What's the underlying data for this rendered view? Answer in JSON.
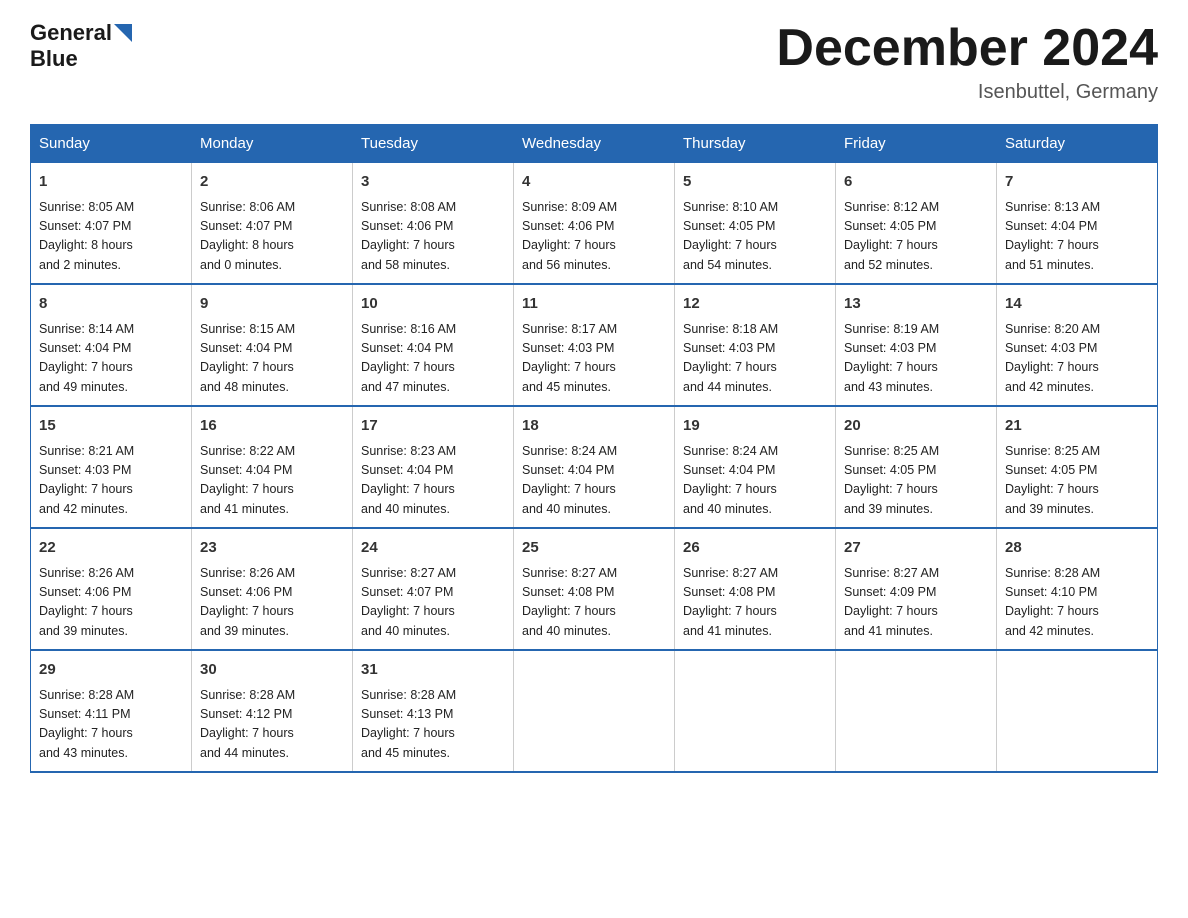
{
  "header": {
    "logo_general": "General",
    "logo_blue": "Blue",
    "title": "December 2024",
    "location": "Isenbuttel, Germany"
  },
  "days_of_week": [
    "Sunday",
    "Monday",
    "Tuesday",
    "Wednesday",
    "Thursday",
    "Friday",
    "Saturday"
  ],
  "weeks": [
    [
      {
        "day": "1",
        "sunrise": "8:05 AM",
        "sunset": "4:07 PM",
        "daylight": "8 hours and 2 minutes."
      },
      {
        "day": "2",
        "sunrise": "8:06 AM",
        "sunset": "4:07 PM",
        "daylight": "8 hours and 0 minutes."
      },
      {
        "day": "3",
        "sunrise": "8:08 AM",
        "sunset": "4:06 PM",
        "daylight": "7 hours and 58 minutes."
      },
      {
        "day": "4",
        "sunrise": "8:09 AM",
        "sunset": "4:06 PM",
        "daylight": "7 hours and 56 minutes."
      },
      {
        "day": "5",
        "sunrise": "8:10 AM",
        "sunset": "4:05 PM",
        "daylight": "7 hours and 54 minutes."
      },
      {
        "day": "6",
        "sunrise": "8:12 AM",
        "sunset": "4:05 PM",
        "daylight": "7 hours and 52 minutes."
      },
      {
        "day": "7",
        "sunrise": "8:13 AM",
        "sunset": "4:04 PM",
        "daylight": "7 hours and 51 minutes."
      }
    ],
    [
      {
        "day": "8",
        "sunrise": "8:14 AM",
        "sunset": "4:04 PM",
        "daylight": "7 hours and 49 minutes."
      },
      {
        "day": "9",
        "sunrise": "8:15 AM",
        "sunset": "4:04 PM",
        "daylight": "7 hours and 48 minutes."
      },
      {
        "day": "10",
        "sunrise": "8:16 AM",
        "sunset": "4:04 PM",
        "daylight": "7 hours and 47 minutes."
      },
      {
        "day": "11",
        "sunrise": "8:17 AM",
        "sunset": "4:03 PM",
        "daylight": "7 hours and 45 minutes."
      },
      {
        "day": "12",
        "sunrise": "8:18 AM",
        "sunset": "4:03 PM",
        "daylight": "7 hours and 44 minutes."
      },
      {
        "day": "13",
        "sunrise": "8:19 AM",
        "sunset": "4:03 PM",
        "daylight": "7 hours and 43 minutes."
      },
      {
        "day": "14",
        "sunrise": "8:20 AM",
        "sunset": "4:03 PM",
        "daylight": "7 hours and 42 minutes."
      }
    ],
    [
      {
        "day": "15",
        "sunrise": "8:21 AM",
        "sunset": "4:03 PM",
        "daylight": "7 hours and 42 minutes."
      },
      {
        "day": "16",
        "sunrise": "8:22 AM",
        "sunset": "4:04 PM",
        "daylight": "7 hours and 41 minutes."
      },
      {
        "day": "17",
        "sunrise": "8:23 AM",
        "sunset": "4:04 PM",
        "daylight": "7 hours and 40 minutes."
      },
      {
        "day": "18",
        "sunrise": "8:24 AM",
        "sunset": "4:04 PM",
        "daylight": "7 hours and 40 minutes."
      },
      {
        "day": "19",
        "sunrise": "8:24 AM",
        "sunset": "4:04 PM",
        "daylight": "7 hours and 40 minutes."
      },
      {
        "day": "20",
        "sunrise": "8:25 AM",
        "sunset": "4:05 PM",
        "daylight": "7 hours and 39 minutes."
      },
      {
        "day": "21",
        "sunrise": "8:25 AM",
        "sunset": "4:05 PM",
        "daylight": "7 hours and 39 minutes."
      }
    ],
    [
      {
        "day": "22",
        "sunrise": "8:26 AM",
        "sunset": "4:06 PM",
        "daylight": "7 hours and 39 minutes."
      },
      {
        "day": "23",
        "sunrise": "8:26 AM",
        "sunset": "4:06 PM",
        "daylight": "7 hours and 39 minutes."
      },
      {
        "day": "24",
        "sunrise": "8:27 AM",
        "sunset": "4:07 PM",
        "daylight": "7 hours and 40 minutes."
      },
      {
        "day": "25",
        "sunrise": "8:27 AM",
        "sunset": "4:08 PM",
        "daylight": "7 hours and 40 minutes."
      },
      {
        "day": "26",
        "sunrise": "8:27 AM",
        "sunset": "4:08 PM",
        "daylight": "7 hours and 41 minutes."
      },
      {
        "day": "27",
        "sunrise": "8:27 AM",
        "sunset": "4:09 PM",
        "daylight": "7 hours and 41 minutes."
      },
      {
        "day": "28",
        "sunrise": "8:28 AM",
        "sunset": "4:10 PM",
        "daylight": "7 hours and 42 minutes."
      }
    ],
    [
      {
        "day": "29",
        "sunrise": "8:28 AM",
        "sunset": "4:11 PM",
        "daylight": "7 hours and 43 minutes."
      },
      {
        "day": "30",
        "sunrise": "8:28 AM",
        "sunset": "4:12 PM",
        "daylight": "7 hours and 44 minutes."
      },
      {
        "day": "31",
        "sunrise": "8:28 AM",
        "sunset": "4:13 PM",
        "daylight": "7 hours and 45 minutes."
      },
      null,
      null,
      null,
      null
    ]
  ],
  "labels": {
    "sunrise": "Sunrise:",
    "sunset": "Sunset:",
    "daylight": "Daylight:"
  }
}
